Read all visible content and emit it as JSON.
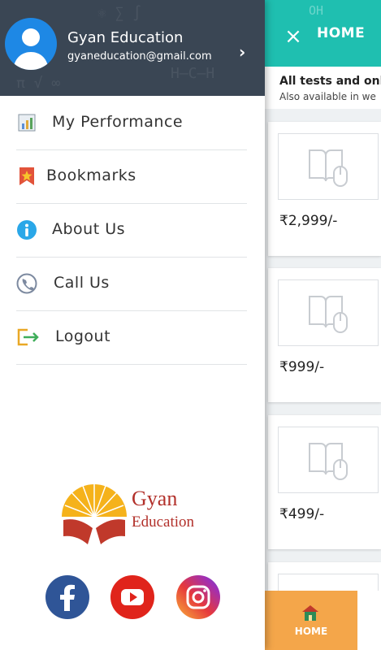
{
  "header": {
    "close_glyph": "×",
    "title": "HOME",
    "background_text": "OH"
  },
  "notice": {
    "line1": "All tests and onli",
    "line2": "Also available in we"
  },
  "cards": [
    {
      "price": "₹2,999/-"
    },
    {
      "price": "₹999/-"
    },
    {
      "price": "₹499/-"
    }
  ],
  "bottom_nav": {
    "home_label": "HOME"
  },
  "drawer": {
    "user_name": "Gyan Education",
    "user_email": "gyaneducation@gmail.com",
    "items": [
      {
        "label": "My Performance",
        "icon": "chart-icon"
      },
      {
        "label": "Bookmarks",
        "icon": "bookmark-icon"
      },
      {
        "label": "About Us",
        "icon": "info-icon"
      },
      {
        "label": "Call Us",
        "icon": "phone-icon"
      },
      {
        "label": "Logout",
        "icon": "logout-icon"
      }
    ],
    "logo": {
      "line1": "Gyan",
      "line2": "Education"
    },
    "social": [
      "facebook-icon",
      "youtube-icon",
      "instagram-icon"
    ]
  },
  "colors": {
    "accent": "#1fbfb0",
    "drawer_header": "#3a4654",
    "bottom_home": "#f4a64a",
    "logo_red": "#c0392b",
    "logo_gold": "#f5b21b"
  }
}
